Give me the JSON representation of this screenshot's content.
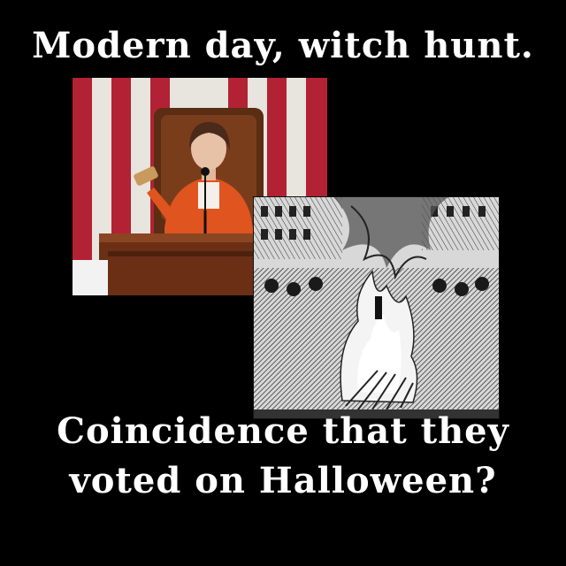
{
  "meme": {
    "top_caption": "Modern day, witch hunt.",
    "bottom_caption_line1": "Coincidence that they",
    "bottom_caption_line2": "voted on Halloween?"
  },
  "colors": {
    "background": "#000000",
    "text": "#ffffff",
    "flag_red": "#b22234",
    "flag_white": "#e8e4de",
    "jacket": "#e0541f",
    "wood": "#6b2f16"
  },
  "images": {
    "left_photo": "woman-with-gavel-at-podium-photo",
    "right_photo": "engraving-of-burning-at-the-stake"
  }
}
